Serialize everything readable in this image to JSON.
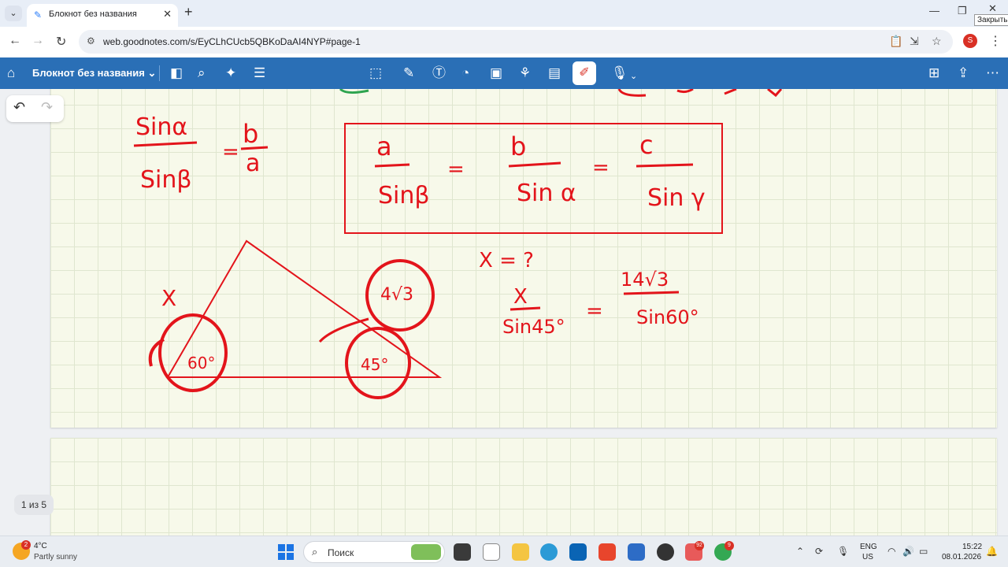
{
  "browser": {
    "tab_menu_icon": "chevron-down-icon",
    "tab_title": "Блокнот без названия",
    "tab_close": "✕",
    "new_tab": "+",
    "window_controls": {
      "minimize": "—",
      "restore": "❐",
      "close": "✕"
    },
    "close_tooltip": "Закрыть",
    "url": "web.goodnotes.com/s/EyCLhCUcb5QBKoDaAI4NYP#page-1",
    "profile_initial": "S"
  },
  "app": {
    "notebook_title": "Блокнот без названия",
    "title_chevron": "⌄",
    "accent_color": "#2a6fb6",
    "ink_color": "#e3141b"
  },
  "canvas": {
    "page_indicator": "1 из 5"
  },
  "handwriting": {
    "top_left_num": "Sinα",
    "top_left_den": "Sinβ",
    "top_left_eq": "=",
    "top_left_rhs_num": "b",
    "top_left_rhs_den": "a",
    "box_a_num": "a",
    "box_a_den": "Sinβ",
    "box_eq1": "=",
    "box_b_num": "b",
    "box_b_den": "Sin α",
    "box_eq2": "=",
    "box_c_num": "c",
    "box_c_den": "Sin γ",
    "side_label": "X",
    "angle_60": "60°",
    "side_known": "4√3",
    "angle_45": "45°",
    "x_question": "X = ?",
    "prop_num": "X",
    "prop_den": "Sin45°",
    "prop_eq": "=",
    "prop_rhs_num": "14√3",
    "prop_rhs_den": "Sin60°"
  },
  "taskbar": {
    "weather_badge": "2",
    "temperature": "4°C",
    "weather": "Partly sunny",
    "search_placeholder": "Поиск",
    "telegram_badge": "92",
    "chrome_badge": "9",
    "lang_line1": "ENG",
    "lang_line2": "US",
    "time": "15:22",
    "date": "08.01.2026"
  }
}
